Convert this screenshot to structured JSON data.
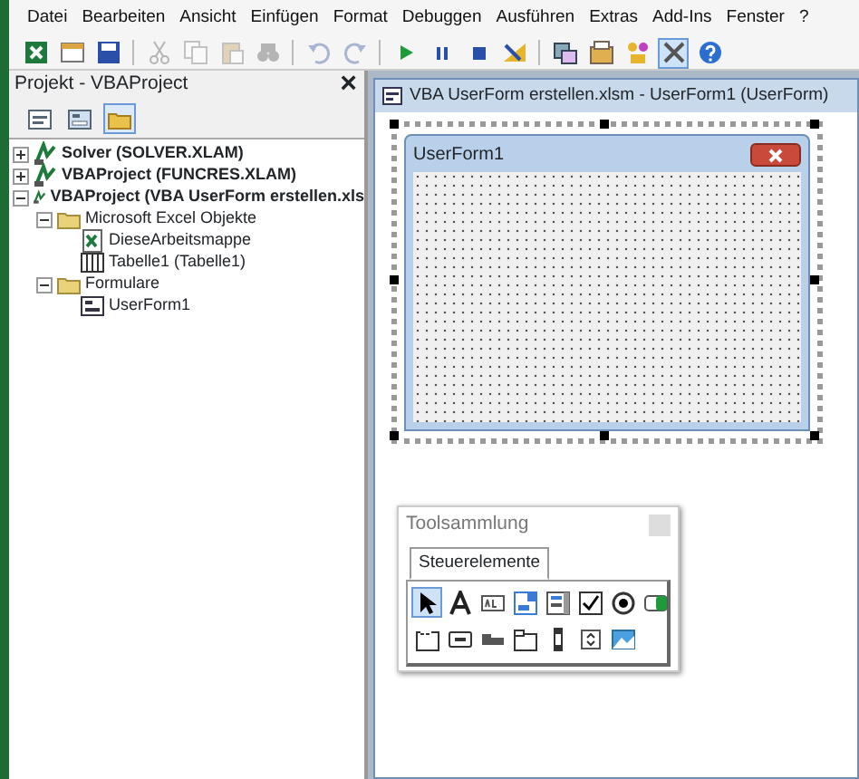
{
  "menu": [
    "Datei",
    "Bearbeiten",
    "Ansicht",
    "Einfügen",
    "Format",
    "Debuggen",
    "Ausführen",
    "Extras",
    "Add-Ins",
    "Fenster",
    "?"
  ],
  "toolbar": [
    {
      "kind": "excel",
      "disabled": false,
      "pressed": false
    },
    {
      "kind": "insert",
      "disabled": false,
      "pressed": false
    },
    {
      "kind": "save",
      "disabled": false,
      "pressed": false
    },
    {
      "kind": "sep"
    },
    {
      "kind": "cut",
      "disabled": true,
      "pressed": false
    },
    {
      "kind": "copy",
      "disabled": true,
      "pressed": false
    },
    {
      "kind": "paste",
      "disabled": true,
      "pressed": false
    },
    {
      "kind": "find",
      "disabled": true,
      "pressed": false
    },
    {
      "kind": "sep"
    },
    {
      "kind": "undo",
      "disabled": true,
      "pressed": false
    },
    {
      "kind": "redo",
      "disabled": true,
      "pressed": false
    },
    {
      "kind": "sep"
    },
    {
      "kind": "run",
      "disabled": false,
      "pressed": false
    },
    {
      "kind": "pause",
      "disabled": false,
      "pressed": false
    },
    {
      "kind": "stop",
      "disabled": false,
      "pressed": false
    },
    {
      "kind": "design",
      "disabled": false,
      "pressed": false
    },
    {
      "kind": "sep"
    },
    {
      "kind": "explorer",
      "disabled": false,
      "pressed": false
    },
    {
      "kind": "properties",
      "disabled": false,
      "pressed": false
    },
    {
      "kind": "browser",
      "disabled": false,
      "pressed": false
    },
    {
      "kind": "toolbox",
      "disabled": false,
      "pressed": true
    },
    {
      "kind": "help",
      "disabled": false,
      "pressed": false
    }
  ],
  "project_panel": {
    "title": "Projekt - VBAProject",
    "close": "×",
    "view_buttons": [
      {
        "kind": "code",
        "selected": false
      },
      {
        "kind": "object",
        "selected": false
      },
      {
        "kind": "folders",
        "selected": true
      }
    ],
    "tree": [
      {
        "label": "Solver (SOLVER.XLAM)",
        "kind": "project",
        "expanded": false
      },
      {
        "label": "VBAProject (FUNCRES.XLAM)",
        "kind": "project",
        "expanded": false
      },
      {
        "label": "VBAProject (VBA UserForm erstellen.xls",
        "kind": "project",
        "expanded": true,
        "children": [
          {
            "label": "Microsoft Excel Objekte",
            "kind": "folder",
            "expanded": true,
            "children": [
              {
                "label": "DieseArbeitsmappe",
                "kind": "workbook"
              },
              {
                "label": "Tabelle1 (Tabelle1)",
                "kind": "sheet"
              }
            ]
          },
          {
            "label": "Formulare",
            "kind": "folder",
            "expanded": true,
            "children": [
              {
                "label": "UserForm1",
                "kind": "form"
              }
            ]
          }
        ]
      }
    ]
  },
  "designer": {
    "title": "VBA UserForm erstellen.xlsm - UserForm1 (UserForm)",
    "form": {
      "caption": "UserForm1"
    }
  },
  "toolbox": {
    "title": "Toolsammlung",
    "tabs": [
      {
        "label": "Steuerelemente",
        "selected": true
      }
    ],
    "controls": [
      {
        "kind": "pointer",
        "selected": true
      },
      {
        "kind": "label",
        "selected": false
      },
      {
        "kind": "textbox",
        "selected": false
      },
      {
        "kind": "combobox",
        "selected": false
      },
      {
        "kind": "listbox",
        "selected": false
      },
      {
        "kind": "checkbox",
        "selected": false
      },
      {
        "kind": "option",
        "selected": false
      },
      {
        "kind": "toggle",
        "selected": false
      },
      {
        "kind": "frame",
        "selected": false
      },
      {
        "kind": "button",
        "selected": false
      },
      {
        "kind": "tabstrip",
        "selected": false
      },
      {
        "kind": "multipage",
        "selected": false
      },
      {
        "kind": "scrollbar",
        "selected": false
      },
      {
        "kind": "spin",
        "selected": false
      },
      {
        "kind": "image",
        "selected": false
      }
    ]
  }
}
